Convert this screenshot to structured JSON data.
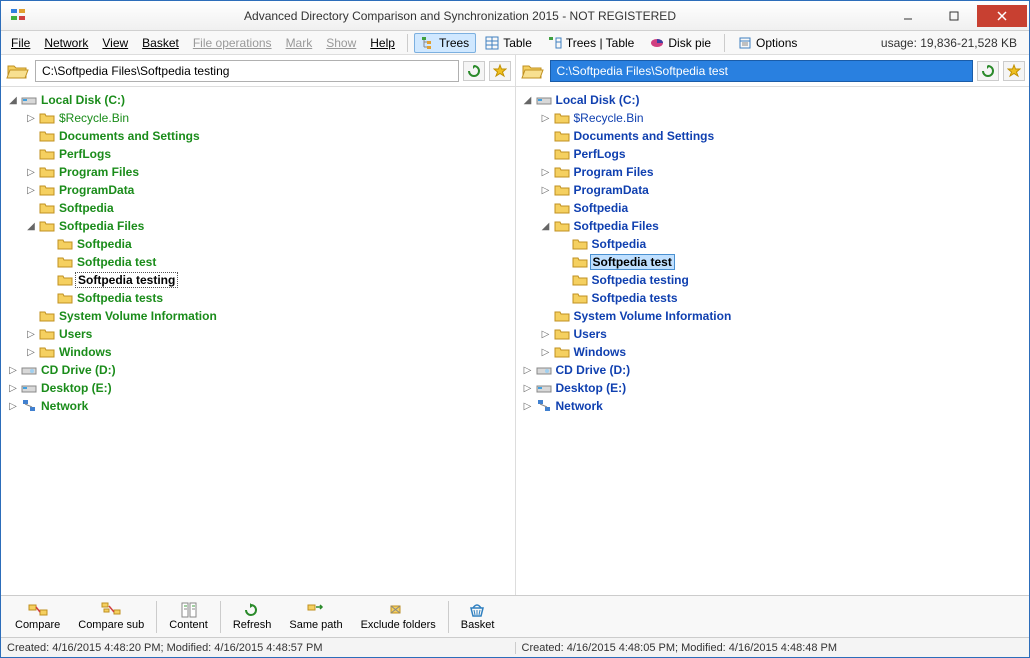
{
  "title": "Advanced Directory Comparison and Synchronization 2015 - NOT REGISTERED",
  "menu": {
    "file": "File",
    "network": "Network",
    "view": "View",
    "basket": "Basket",
    "fileops": "File operations",
    "mark": "Mark",
    "show": "Show",
    "help": "Help"
  },
  "toolbar": {
    "trees": "Trees",
    "table": "Table",
    "treestable": "Trees | Table",
    "diskpie": "Disk pie",
    "options": "Options"
  },
  "usage": "usage: 19,836-21,528 KB",
  "paths": {
    "left": "C:\\Softpedia Files\\Softpedia testing",
    "right": "C:\\Softpedia Files\\Softpedia test"
  },
  "tree": {
    "localDisk": "Local Disk (C:)",
    "recycle": "$Recycle.Bin",
    "docs": "Documents and Settings",
    "perflogs": "PerfLogs",
    "progfiles": "Program Files",
    "progdata": "ProgramData",
    "softpedia": "Softpedia",
    "softpediaFiles": "Softpedia Files",
    "sf_softpedia": "Softpedia",
    "sf_test": "Softpedia test",
    "sf_testing": "Softpedia testing",
    "sf_tests": "Softpedia tests",
    "sysvol": "System Volume Information",
    "users": "Users",
    "windows": "Windows",
    "cddrive": "CD Drive (D:)",
    "desktop": "Desktop (E:)",
    "network": "Network"
  },
  "bottomTools": {
    "compare": "Compare",
    "comparesub": "Compare sub",
    "content": "Content",
    "refresh": "Refresh",
    "samepath": "Same path",
    "exclude": "Exclude folders",
    "basket": "Basket"
  },
  "status": {
    "left": "Created: 4/16/2015 4:48:20 PM; Modified: 4/16/2015 4:48:57 PM",
    "right": "Created: 4/16/2015 4:48:05 PM; Modified: 4/16/2015 4:48:48 PM"
  }
}
